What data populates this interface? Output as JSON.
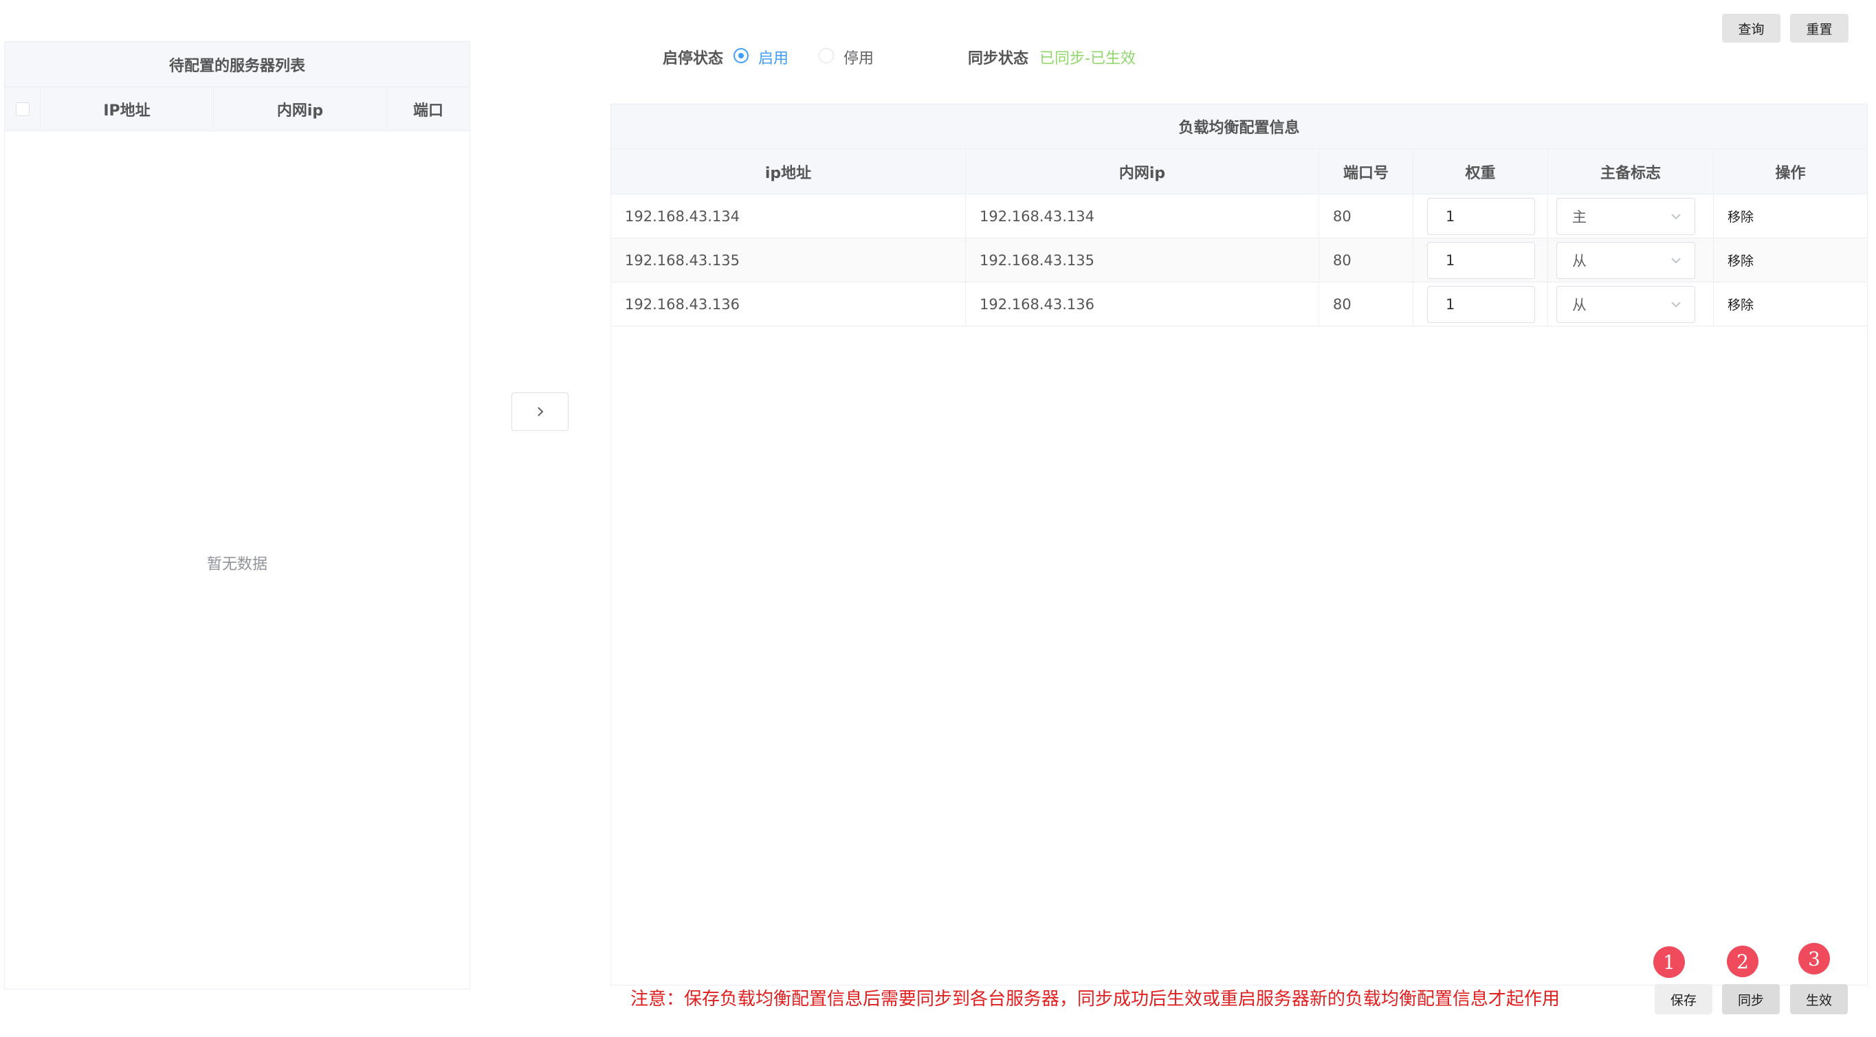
{
  "toolbar": {
    "query_label": "查询",
    "reset_label": "重置"
  },
  "left_panel": {
    "title": "待配置的服务器列表",
    "columns": [
      "IP地址",
      "内网ip",
      "端口"
    ],
    "empty_text": "暂无数据"
  },
  "filters": {
    "status_label": "启停状态",
    "options": [
      {
        "label": "启用",
        "selected": true
      },
      {
        "label": "停用",
        "selected": false
      }
    ],
    "sync_label": "同步状态",
    "sync_value": "已同步-已生效",
    "sync_color": "#8fd76a",
    "accent_color": "#409eff"
  },
  "transfer": {
    "icon": "chevron-right-icon"
  },
  "right_panel": {
    "title": "负载均衡配置信息",
    "columns": [
      "ip地址",
      "内网ip",
      "端口号",
      "权重",
      "主备标志",
      "操作"
    ],
    "rows": [
      {
        "ip": "192.168.43.134",
        "inner_ip": "192.168.43.134",
        "port": "80",
        "weight": "1",
        "flag": "主",
        "action": "移除"
      },
      {
        "ip": "192.168.43.135",
        "inner_ip": "192.168.43.135",
        "port": "80",
        "weight": "1",
        "flag": "从",
        "action": "移除"
      },
      {
        "ip": "192.168.43.136",
        "inner_ip": "192.168.43.136",
        "port": "80",
        "weight": "1",
        "flag": "从",
        "action": "移除"
      }
    ]
  },
  "notice": "注意：保存负载均衡配置信息后需要同步到各台服务器，同步成功后生效或重启服务器新的负载均衡配置信息才起作用",
  "actions": {
    "save_label": "保存",
    "sync_label": "同步",
    "apply_label": "生效",
    "steps": [
      "1",
      "2",
      "3"
    ],
    "step_color": "#ef4b5d"
  }
}
